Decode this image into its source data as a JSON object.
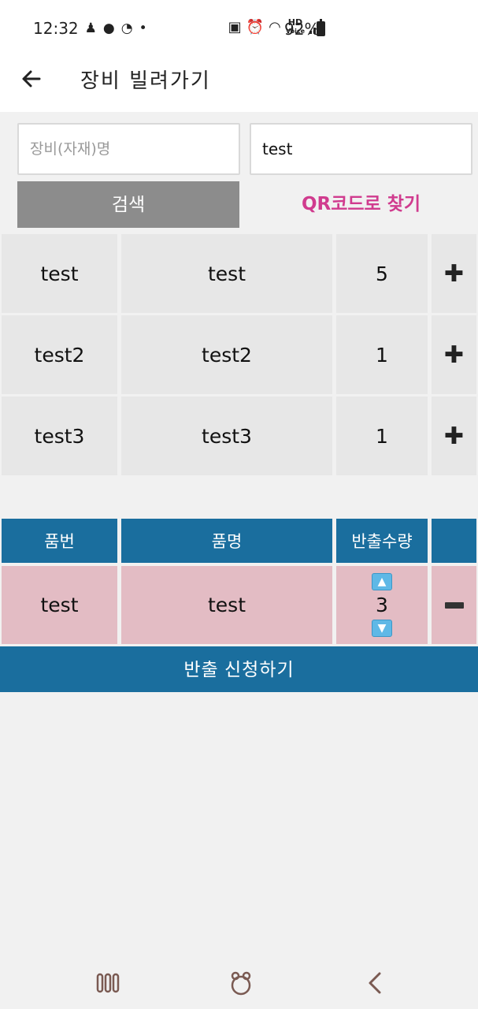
{
  "status_bar": {
    "time": "12:32",
    "battery": "92%",
    "hd_top": "HD",
    "hd_bottom": "Voice"
  },
  "app_bar": {
    "title": "장비 빌려가기"
  },
  "search": {
    "name_placeholder": "장비(자재)명",
    "code_value": "test",
    "search_label": "검색",
    "qr_label": "QR코드로 찾기"
  },
  "results": [
    {
      "col1": "test",
      "col2": "test",
      "col3": "5"
    },
    {
      "col1": "test2",
      "col2": "test2",
      "col3": "1"
    },
    {
      "col1": "test3",
      "col2": "test3",
      "col3": "1"
    }
  ],
  "cart": {
    "headers": [
      "품번",
      "품명",
      "반출수량",
      ""
    ],
    "items": [
      {
        "part_no": "test",
        "name": "test",
        "quantity": "3"
      }
    ],
    "submit_label": "반출 신청하기"
  },
  "colors": {
    "header_blue": "#1a6e9e",
    "cart_row_pink": "#e3bcc4",
    "qr_link_pink": "#d03b8e",
    "search_button_gray": "#8c8c8c"
  },
  "icons": {
    "back": "arrow-left-icon",
    "add": "plus-icon",
    "remove": "minus-icon",
    "qty_up": "triangle-up-icon",
    "qty_down": "triangle-down-icon",
    "nav_recent": "recent-apps-icon",
    "nav_home": "home-icon",
    "nav_back": "chevron-left-icon"
  }
}
